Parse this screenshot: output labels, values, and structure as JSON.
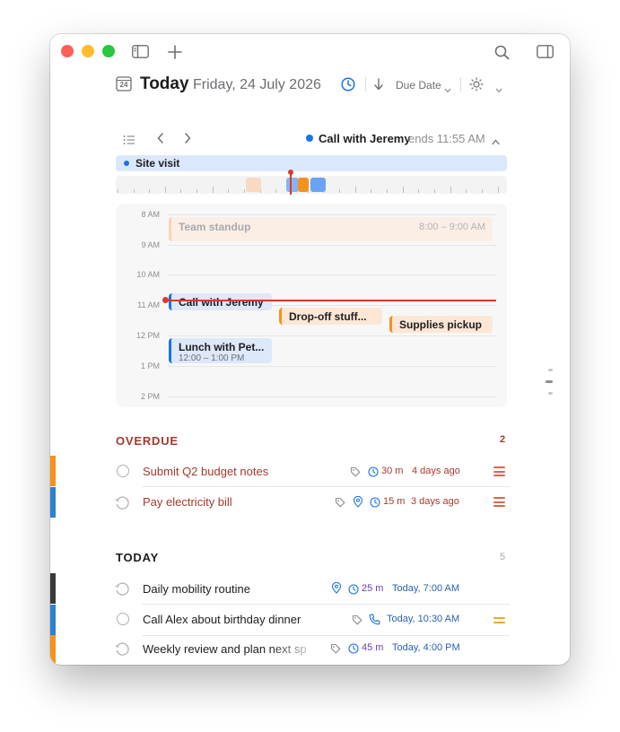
{
  "header": {
    "calendar_day": "24",
    "title": "Today",
    "date": "Friday, 24 July 2026",
    "sort_label": "Due Date"
  },
  "timeline_bar": {
    "current_event": "Call with Jeremy",
    "current_event_ends": "ends 11:55 AM",
    "all_day_event": "Site visit"
  },
  "schedule": {
    "hours": [
      "8 AM",
      "9 AM",
      "10 AM",
      "11 AM",
      "12 PM",
      "1 PM",
      "2 PM"
    ],
    "events": [
      {
        "title": "Team standup",
        "time": "8:00 – 9:00 AM"
      },
      {
        "title": "Call with Jeremy"
      },
      {
        "title": "Drop-off stuff..."
      },
      {
        "title": "Supplies pickup"
      },
      {
        "title": "Lunch with Pet...",
        "time": "12:00 – 1:00 PM"
      }
    ]
  },
  "overdue": {
    "title": "OVERDUE",
    "count": "2",
    "tasks": [
      {
        "title": "Submit Q2 budget notes",
        "duration": "30 m",
        "due": "4 days ago"
      },
      {
        "title": "Pay electricity bill",
        "duration": "15 m",
        "due": "3 days ago"
      }
    ]
  },
  "today": {
    "title": "TODAY",
    "count": "5",
    "tasks": [
      {
        "title": "Daily mobility routine",
        "duration": "25 m",
        "due": "Today, 7:00 AM"
      },
      {
        "title": "Call Alex about birthday dinner",
        "due": "Today, 10:30 AM"
      },
      {
        "title": "Weekly review and plan next sp",
        "duration": "45 m",
        "due": "Today, 4:00 PM"
      }
    ]
  },
  "colors": {
    "accent_blue": "#1a73e8",
    "overdue_red": "#a33a2e",
    "orange": "#f5921e",
    "now_line": "#d93a2b"
  }
}
